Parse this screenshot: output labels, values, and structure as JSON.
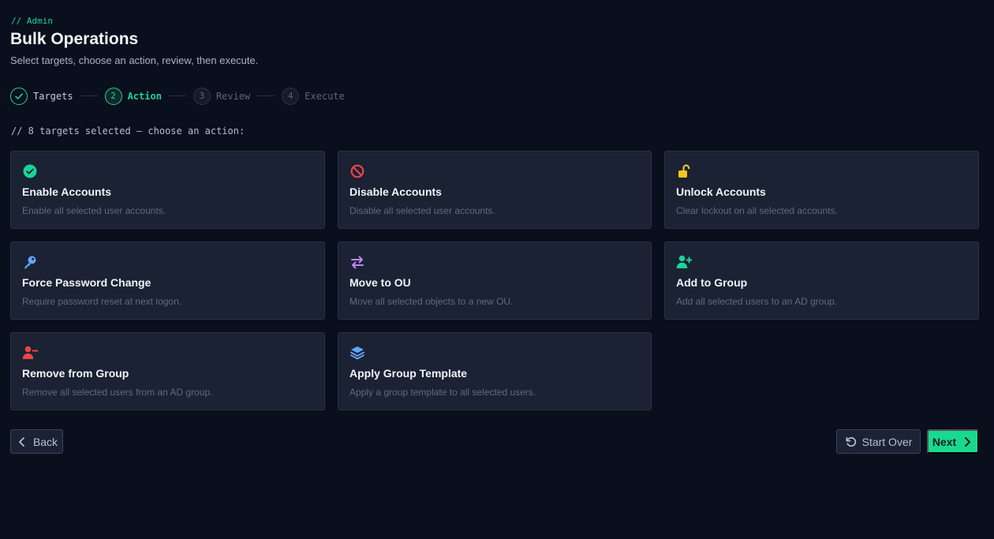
{
  "header": {
    "breadcrumb": "// Admin",
    "title": "Bulk Operations",
    "subtitle": "Select targets, choose an action, review, then execute."
  },
  "stepper": {
    "steps": [
      {
        "number": "1",
        "label": "Targets",
        "state": "done"
      },
      {
        "number": "2",
        "label": "Action",
        "state": "active"
      },
      {
        "number": "3",
        "label": "Review",
        "state": "todo"
      },
      {
        "number": "4",
        "label": "Execute",
        "state": "todo"
      }
    ]
  },
  "hint": "// 8 targets selected — choose an action:",
  "actions": [
    {
      "title": "Enable Accounts",
      "description": "Enable all selected user accounts.",
      "icon": "check-circle-icon",
      "color": "#19d39a"
    },
    {
      "title": "Disable Accounts",
      "description": "Disable all selected user accounts.",
      "icon": "ban-icon",
      "color": "#ef4444"
    },
    {
      "title": "Unlock Accounts",
      "description": "Clear lockout on all selected accounts.",
      "icon": "unlock-icon",
      "color": "#f5c518"
    },
    {
      "title": "Force Password Change",
      "description": "Require password reset at next logon.",
      "icon": "key-icon",
      "color": "#60a5fa"
    },
    {
      "title": "Move to OU",
      "description": "Move all selected objects to a new OU.",
      "icon": "arrows-swap-icon",
      "color": "#c084fc"
    },
    {
      "title": "Add to Group",
      "description": "Add all selected users to an AD group.",
      "icon": "user-plus-icon",
      "color": "#19d39a"
    },
    {
      "title": "Remove from Group",
      "description": "Remove all selected users from an AD group.",
      "icon": "user-minus-icon",
      "color": "#ef4444"
    },
    {
      "title": "Apply Group Template",
      "description": "Apply a group template to all selected users.",
      "icon": "layers-icon",
      "color": "#60a5fa"
    }
  ],
  "footer": {
    "back_label": "Back",
    "start_over_label": "Start Over",
    "next_label": "Next"
  },
  "colors": {
    "accent": "#19d39a",
    "background": "#0a0f1d",
    "card": "#1a2233"
  }
}
